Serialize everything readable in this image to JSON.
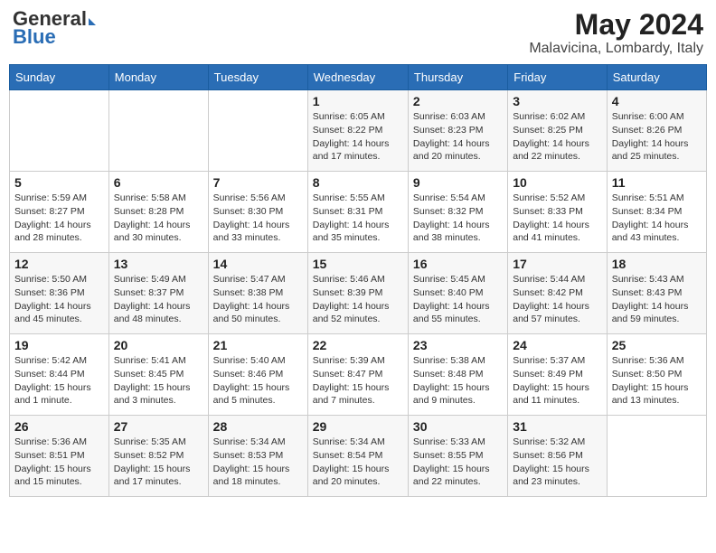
{
  "header": {
    "logo_general": "General",
    "logo_blue": "Blue",
    "title": "May 2024",
    "location": "Malavicina, Lombardy, Italy"
  },
  "days_of_week": [
    "Sunday",
    "Monday",
    "Tuesday",
    "Wednesday",
    "Thursday",
    "Friday",
    "Saturday"
  ],
  "weeks": [
    [
      {
        "day": "",
        "info": ""
      },
      {
        "day": "",
        "info": ""
      },
      {
        "day": "",
        "info": ""
      },
      {
        "day": "1",
        "info": "Sunrise: 6:05 AM\nSunset: 8:22 PM\nDaylight: 14 hours and 17 minutes."
      },
      {
        "day": "2",
        "info": "Sunrise: 6:03 AM\nSunset: 8:23 PM\nDaylight: 14 hours and 20 minutes."
      },
      {
        "day": "3",
        "info": "Sunrise: 6:02 AM\nSunset: 8:25 PM\nDaylight: 14 hours and 22 minutes."
      },
      {
        "day": "4",
        "info": "Sunrise: 6:00 AM\nSunset: 8:26 PM\nDaylight: 14 hours and 25 minutes."
      }
    ],
    [
      {
        "day": "5",
        "info": "Sunrise: 5:59 AM\nSunset: 8:27 PM\nDaylight: 14 hours and 28 minutes."
      },
      {
        "day": "6",
        "info": "Sunrise: 5:58 AM\nSunset: 8:28 PM\nDaylight: 14 hours and 30 minutes."
      },
      {
        "day": "7",
        "info": "Sunrise: 5:56 AM\nSunset: 8:30 PM\nDaylight: 14 hours and 33 minutes."
      },
      {
        "day": "8",
        "info": "Sunrise: 5:55 AM\nSunset: 8:31 PM\nDaylight: 14 hours and 35 minutes."
      },
      {
        "day": "9",
        "info": "Sunrise: 5:54 AM\nSunset: 8:32 PM\nDaylight: 14 hours and 38 minutes."
      },
      {
        "day": "10",
        "info": "Sunrise: 5:52 AM\nSunset: 8:33 PM\nDaylight: 14 hours and 41 minutes."
      },
      {
        "day": "11",
        "info": "Sunrise: 5:51 AM\nSunset: 8:34 PM\nDaylight: 14 hours and 43 minutes."
      }
    ],
    [
      {
        "day": "12",
        "info": "Sunrise: 5:50 AM\nSunset: 8:36 PM\nDaylight: 14 hours and 45 minutes."
      },
      {
        "day": "13",
        "info": "Sunrise: 5:49 AM\nSunset: 8:37 PM\nDaylight: 14 hours and 48 minutes."
      },
      {
        "day": "14",
        "info": "Sunrise: 5:47 AM\nSunset: 8:38 PM\nDaylight: 14 hours and 50 minutes."
      },
      {
        "day": "15",
        "info": "Sunrise: 5:46 AM\nSunset: 8:39 PM\nDaylight: 14 hours and 52 minutes."
      },
      {
        "day": "16",
        "info": "Sunrise: 5:45 AM\nSunset: 8:40 PM\nDaylight: 14 hours and 55 minutes."
      },
      {
        "day": "17",
        "info": "Sunrise: 5:44 AM\nSunset: 8:42 PM\nDaylight: 14 hours and 57 minutes."
      },
      {
        "day": "18",
        "info": "Sunrise: 5:43 AM\nSunset: 8:43 PM\nDaylight: 14 hours and 59 minutes."
      }
    ],
    [
      {
        "day": "19",
        "info": "Sunrise: 5:42 AM\nSunset: 8:44 PM\nDaylight: 15 hours and 1 minute."
      },
      {
        "day": "20",
        "info": "Sunrise: 5:41 AM\nSunset: 8:45 PM\nDaylight: 15 hours and 3 minutes."
      },
      {
        "day": "21",
        "info": "Sunrise: 5:40 AM\nSunset: 8:46 PM\nDaylight: 15 hours and 5 minutes."
      },
      {
        "day": "22",
        "info": "Sunrise: 5:39 AM\nSunset: 8:47 PM\nDaylight: 15 hours and 7 minutes."
      },
      {
        "day": "23",
        "info": "Sunrise: 5:38 AM\nSunset: 8:48 PM\nDaylight: 15 hours and 9 minutes."
      },
      {
        "day": "24",
        "info": "Sunrise: 5:37 AM\nSunset: 8:49 PM\nDaylight: 15 hours and 11 minutes."
      },
      {
        "day": "25",
        "info": "Sunrise: 5:36 AM\nSunset: 8:50 PM\nDaylight: 15 hours and 13 minutes."
      }
    ],
    [
      {
        "day": "26",
        "info": "Sunrise: 5:36 AM\nSunset: 8:51 PM\nDaylight: 15 hours and 15 minutes."
      },
      {
        "day": "27",
        "info": "Sunrise: 5:35 AM\nSunset: 8:52 PM\nDaylight: 15 hours and 17 minutes."
      },
      {
        "day": "28",
        "info": "Sunrise: 5:34 AM\nSunset: 8:53 PM\nDaylight: 15 hours and 18 minutes."
      },
      {
        "day": "29",
        "info": "Sunrise: 5:34 AM\nSunset: 8:54 PM\nDaylight: 15 hours and 20 minutes."
      },
      {
        "day": "30",
        "info": "Sunrise: 5:33 AM\nSunset: 8:55 PM\nDaylight: 15 hours and 22 minutes."
      },
      {
        "day": "31",
        "info": "Sunrise: 5:32 AM\nSunset: 8:56 PM\nDaylight: 15 hours and 23 minutes."
      },
      {
        "day": "",
        "info": ""
      }
    ]
  ]
}
